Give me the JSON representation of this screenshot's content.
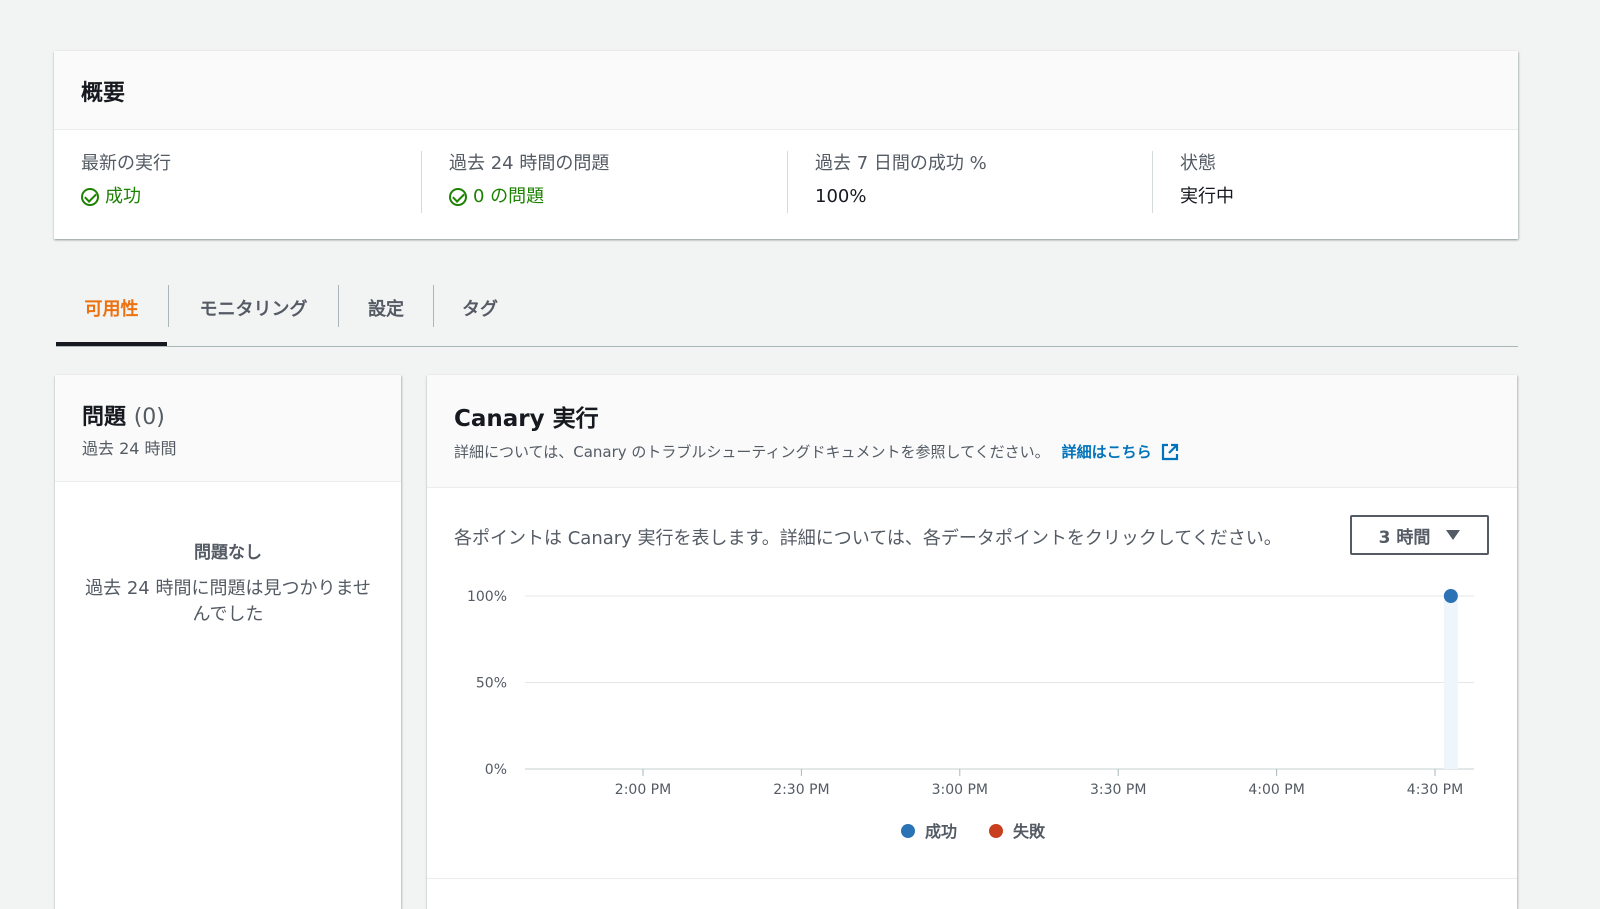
{
  "overview": {
    "title": "概要",
    "latest_run": {
      "label": "最新の実行",
      "value": "成功"
    },
    "issues_24h": {
      "label": "過去 24 時間の問題",
      "value": "0 の問題"
    },
    "success_7d": {
      "label": "過去 7 日間の成功 %",
      "value": "100%"
    },
    "state": {
      "label": "状態",
      "value": "実行中"
    }
  },
  "tabs": [
    {
      "label": "可用性",
      "active": true
    },
    {
      "label": "モニタリング",
      "active": false
    },
    {
      "label": "設定",
      "active": false
    },
    {
      "label": "タグ",
      "active": false
    }
  ],
  "issues": {
    "title": "問題",
    "count": "(0)",
    "subtitle": "過去 24 時間",
    "empty_title": "問題なし",
    "empty_text": "過去 24 時間に問題は見つかりませんでした"
  },
  "canary": {
    "title": "Canary 実行",
    "description": "詳細については、Canary のトラブルシューティングドキュメントを参照してください。",
    "learn_more": "詳細はこちら",
    "chart_description": "各ポイントは Canary 実行を表します。詳細については、各データポイントをクリックしてください。",
    "time_range": "3 時間"
  },
  "colors": {
    "accent": "#ec7211",
    "success": "#1d8102",
    "link": "#0073bb",
    "series_success": "#2c73b6",
    "series_failure": "#c83f1f"
  },
  "chart_data": {
    "type": "scatter",
    "x_tick_labels": [
      "2:00 PM",
      "2:30 PM",
      "3:00 PM",
      "3:30 PM",
      "4:00 PM",
      "4:30 PM"
    ],
    "y_tick_labels": [
      "100%",
      "50%",
      "0%"
    ],
    "ylim": [
      0,
      100
    ],
    "series": [
      {
        "name": "成功",
        "color": "#2c73b6",
        "points": [
          {
            "x": "4:33 PM",
            "y": 100
          }
        ]
      },
      {
        "name": "失敗",
        "color": "#c83f1f",
        "points": []
      }
    ]
  }
}
